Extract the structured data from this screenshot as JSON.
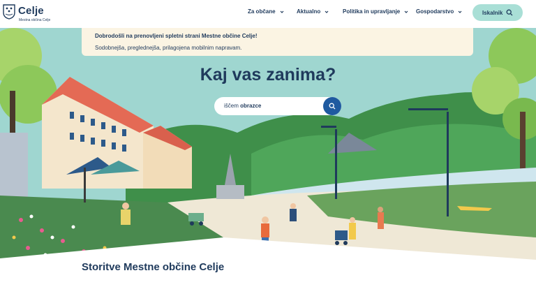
{
  "header": {
    "logo_title": "Celje",
    "logo_subtitle": "Mestna občina Celje",
    "nav": [
      {
        "label": "Za občane"
      },
      {
        "label": "Aktualno"
      },
      {
        "label": "Politika in upravljanje"
      },
      {
        "label": "Gospodarstvo"
      }
    ],
    "search_button_label": "Iskalnik"
  },
  "notice": {
    "title": "Dobrodošli na prenovljeni spletni strani Mestne občine Celje!",
    "text": "Sodobnejša, preglednejša, prilagojena mobilnim napravam."
  },
  "hero": {
    "title": "Kaj vas zanima?",
    "search_prefix": "iščem",
    "search_term": "obrazce"
  },
  "services": {
    "title": "Storitve Mestne občine Celje"
  },
  "colors": {
    "navy": "#1f3a5c",
    "mint": "#a9dfd6",
    "sky": "#9fd6d0",
    "cream": "#fbf4e3",
    "blue_button": "#1f5aa0"
  },
  "icons": [
    "celje-crest-icon",
    "chevron-down-icon",
    "search-icon"
  ]
}
